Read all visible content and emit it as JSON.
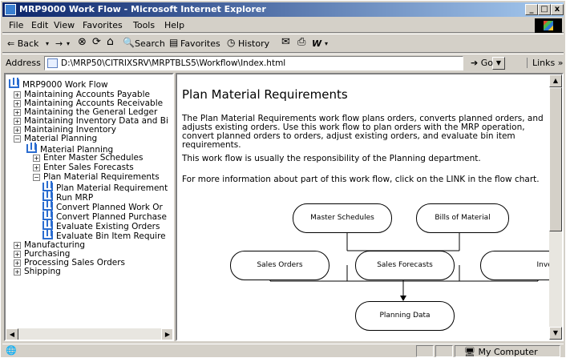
{
  "window": {
    "title": "MRP9000 Work Flow - Microsoft Internet Explorer",
    "controls": {
      "minimize": "_",
      "maximize": "□",
      "close": "x"
    }
  },
  "menu": [
    "File",
    "Edit",
    "View",
    "Favorites",
    "Tools",
    "Help"
  ],
  "toolbar": {
    "back": "⇐ Back",
    "back_arrow": "▾",
    "forward": "→",
    "forward_arrow": "▾",
    "stop": "⊗",
    "refresh": "⟳",
    "home": "⌂",
    "search": "Search",
    "favorites": "Favorites",
    "history": "History",
    "mail": "✉",
    "print": "⎙",
    "edit": "W",
    "edit_arrow": "▾"
  },
  "address": {
    "label": "Address",
    "value": "D:\\MRP50\\CITRIXSRV\\MRPTBLS5\\Workflow\\Index.html",
    "go": "Go",
    "links": "Links »"
  },
  "tree": {
    "root": "MRP9000 Work Flow",
    "items": [
      {
        "label": "Maintaining Accounts Payable",
        "sign": "+"
      },
      {
        "label": "Maintaining Accounts Receivable",
        "sign": "+"
      },
      {
        "label": "Maintaining the General Ledger",
        "sign": "+"
      },
      {
        "label": "Maintaining Inventory Data and Bi",
        "sign": "+"
      },
      {
        "label": "Maintaining Inventory",
        "sign": "+"
      },
      {
        "label": "Material Planning",
        "sign": "−"
      },
      {
        "label": "Material Planning"
      },
      {
        "label": "Enter Master Schedules",
        "sign": "+"
      },
      {
        "label": "Enter Sales Forecasts",
        "sign": "+"
      },
      {
        "label": "Plan Material Requirements",
        "sign": "−"
      },
      {
        "label": "Plan Material Requirement"
      },
      {
        "label": "Run MRP"
      },
      {
        "label": "Convert Planned Work Or"
      },
      {
        "label": "Convert Planned Purchase"
      },
      {
        "label": "Evaluate Existing Orders"
      },
      {
        "label": "Evaluate Bin Item Require"
      },
      {
        "label": "Manufacturing",
        "sign": "+"
      },
      {
        "label": "Purchasing",
        "sign": "+"
      },
      {
        "label": "Processing Sales Orders",
        "sign": "+"
      },
      {
        "label": "Shipping",
        "sign": "+"
      }
    ]
  },
  "content": {
    "heading": "Plan Material Requirements",
    "para1": "The Plan Material Requirements work flow plans orders, converts planned orders, and adjusts existing orders. Use this work flow to plan orders with the MRP operation, convert planned orders to orders, adjust existing orders, and evaluate bin item requirements.",
    "para2": "This work flow is usually the responsibility of the Planning department.",
    "para3": "For more information about part of this work flow, click on the LINK in the flow chart."
  },
  "flowchart": {
    "master_schedules": "Master Schedules",
    "bills_of_material": "Bills of Material",
    "sales_orders": "Sales Orders",
    "sales_forecasts": "Sales Forecasts",
    "inventory": "Inventory",
    "planning_data": "Planning Data"
  },
  "status": {
    "zone": "My Computer"
  }
}
